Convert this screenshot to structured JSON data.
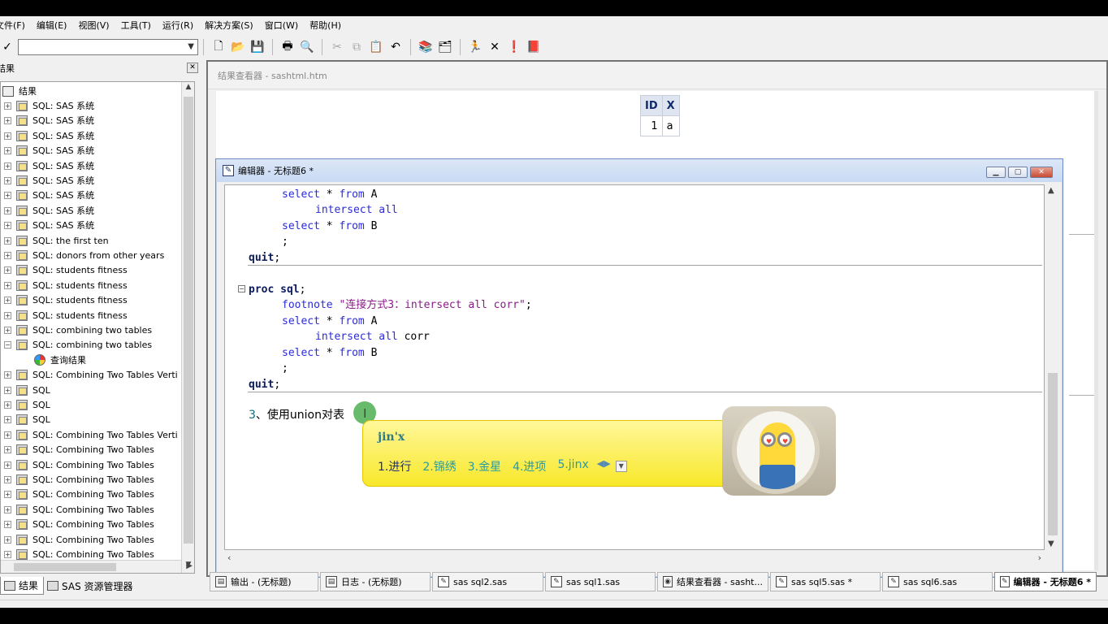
{
  "menubar": {
    "items": [
      "文件(F)",
      "编辑(E)",
      "视图(V)",
      "工具(T)",
      "运行(R)",
      "解决方案(S)",
      "窗口(W)",
      "帮助(H)"
    ]
  },
  "toolbar": {
    "command_value": "",
    "buttons": [
      "new-icon",
      "open-icon",
      "save-icon",
      "print-icon",
      "print-preview-icon",
      "cut-icon",
      "copy-icon",
      "paste-icon",
      "undo-icon",
      "library-icon",
      "explorer-icon",
      "run-icon",
      "clear-icon",
      "help-icon",
      "book-icon"
    ]
  },
  "left_pane": {
    "header_title": "结果",
    "root_label": "结果",
    "items": [
      "SQL:  SAS 系统",
      "SQL:  SAS 系统",
      "SQL:  SAS 系统",
      "SQL:  SAS 系统",
      "SQL:  SAS 系统",
      "SQL:  SAS 系统",
      "SQL:  SAS 系统",
      "SQL:  SAS 系统",
      "SQL:  SAS 系统",
      "SQL:  the first ten",
      "SQL:  donors from other years",
      "SQL:  students fitness",
      "SQL:  students fitness",
      "SQL:  students fitness",
      "SQL:  students fitness",
      "SQL:  combining two tables",
      "SQL:  combining two tables"
    ],
    "child_item": "查询结果",
    "items_after": [
      "SQL:  Combining Two Tables Verti",
      "SQL",
      "SQL",
      "SQL",
      "SQL:  Combining Two Tables Verti",
      "SQL:  Combining Two Tables",
      "SQL:  Combining Two Tables",
      "SQL:  Combining Two Tables",
      "SQL:  Combining Two Tables",
      "SQL:  Combining Two Tables",
      "SQL:  Combining Two Tables",
      "SQL:  Combining Two Tables",
      "SQL:  Combining Two Tables"
    ],
    "tabs": [
      "结果",
      "SAS 资源管理器"
    ]
  },
  "results_viewer": {
    "title": "结果查看器 - sashtml.htm",
    "table": {
      "headers": [
        "ID",
        "X"
      ],
      "rows": [
        [
          "1",
          "a"
        ]
      ]
    }
  },
  "editor": {
    "title": "编辑器 - 无标题6 *",
    "lines": {
      "l1_kw": "select",
      "l1_rest": " * ",
      "l1_kw2": "from",
      "l1_tail": " A",
      "l2_kw": "intersect all",
      "l3_kw": "select",
      "l3_rest": " * ",
      "l3_kw2": "from",
      "l3_tail": " B",
      "l4": ";",
      "l5_kw": "quit",
      "l5_tail": ";",
      "l6_kw": "proc sql",
      "l6_tail": ";",
      "l7_kw": "footnote",
      "l7_str": " \"连接方式3：intersect all corr\"",
      "l7_tail": ";",
      "l8_kw": "select",
      "l8_rest": " * ",
      "l8_kw2": "from",
      "l8_tail": " A",
      "l9_kw": "intersect all",
      "l9_tail": " corr",
      "l10_kw": "select",
      "l10_rest": " * ",
      "l10_kw2": "from",
      "l10_tail": " B",
      "l11": ";",
      "l12_kw": "quit",
      "l12_tail": ";",
      "comment_num": "3",
      "comment_text": "、使用union对表"
    }
  },
  "ime": {
    "input": "jin'x",
    "candidates": [
      "1.进行",
      "2.锦绣",
      "3.金星",
      "4.进项",
      "5.jinx"
    ]
  },
  "tasks": [
    {
      "label": "输出 - (无标题)",
      "icon": "output-icon"
    },
    {
      "label": "日志 - (无标题)",
      "icon": "log-icon"
    },
    {
      "label": "sas sql2.sas",
      "icon": "editor-icon"
    },
    {
      "label": "sas sql1.sas",
      "icon": "editor-icon"
    },
    {
      "label": "结果查看器 - sasht...",
      "icon": "results-viewer-icon"
    },
    {
      "label": "sas sql5.sas *",
      "icon": "editor-icon"
    },
    {
      "label": "sas sql6.sas",
      "icon": "editor-icon"
    },
    {
      "label": "编辑器 - 无标题6 *",
      "icon": "editor-icon"
    }
  ]
}
